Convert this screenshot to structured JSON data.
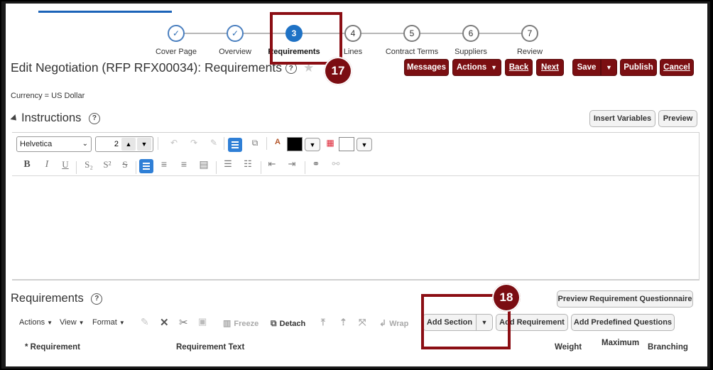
{
  "train": {
    "steps": [
      {
        "num": "✓",
        "label": "Cover Page",
        "state": "done"
      },
      {
        "num": "✓",
        "label": "Overview",
        "state": "done"
      },
      {
        "num": "3",
        "label": "Requirements",
        "state": "current"
      },
      {
        "num": "4",
        "label": "Lines",
        "state": "todo"
      },
      {
        "num": "5",
        "label": "Contract Terms",
        "state": "todo"
      },
      {
        "num": "6",
        "label": "Suppliers",
        "state": "todo"
      },
      {
        "num": "7",
        "label": "Review",
        "state": "todo"
      }
    ]
  },
  "header": {
    "title": "Edit Negotiation (RFP RFX00034): Requirements",
    "help": "?",
    "currency": "Currency = US Dollar"
  },
  "actions": {
    "messages": "Messages",
    "actions": "Actions",
    "back": "Back",
    "next": "Next",
    "save": "Save",
    "publish": "Publish",
    "cancel": "Cancel"
  },
  "instructions": {
    "title": "Instructions",
    "insert_variables": "Insert Variables",
    "preview": "Preview",
    "font": "Helvetica",
    "font_size": "2"
  },
  "requirements": {
    "title": "Requirements",
    "preview_questionnaire": "Preview Requirement Questionnaire",
    "toolbar": {
      "actions": "Actions",
      "view": "View",
      "format": "Format",
      "freeze": "Freeze",
      "detach": "Detach",
      "wrap": "Wrap",
      "add_section": "Add Section",
      "add_requirement": "Add Requirement",
      "add_predefined": "Add Predefined Questions"
    },
    "columns": {
      "requirement": "* Requirement",
      "requirement_text": "Requirement Text",
      "weight": "Weight",
      "maximum": "Maximum",
      "branching": "Branching"
    }
  },
  "callouts": {
    "one": "17",
    "two": "18"
  },
  "colors": {
    "brand_button": "#7b0f12",
    "callout": "#8b0e14",
    "current_step": "#1f72c5"
  }
}
